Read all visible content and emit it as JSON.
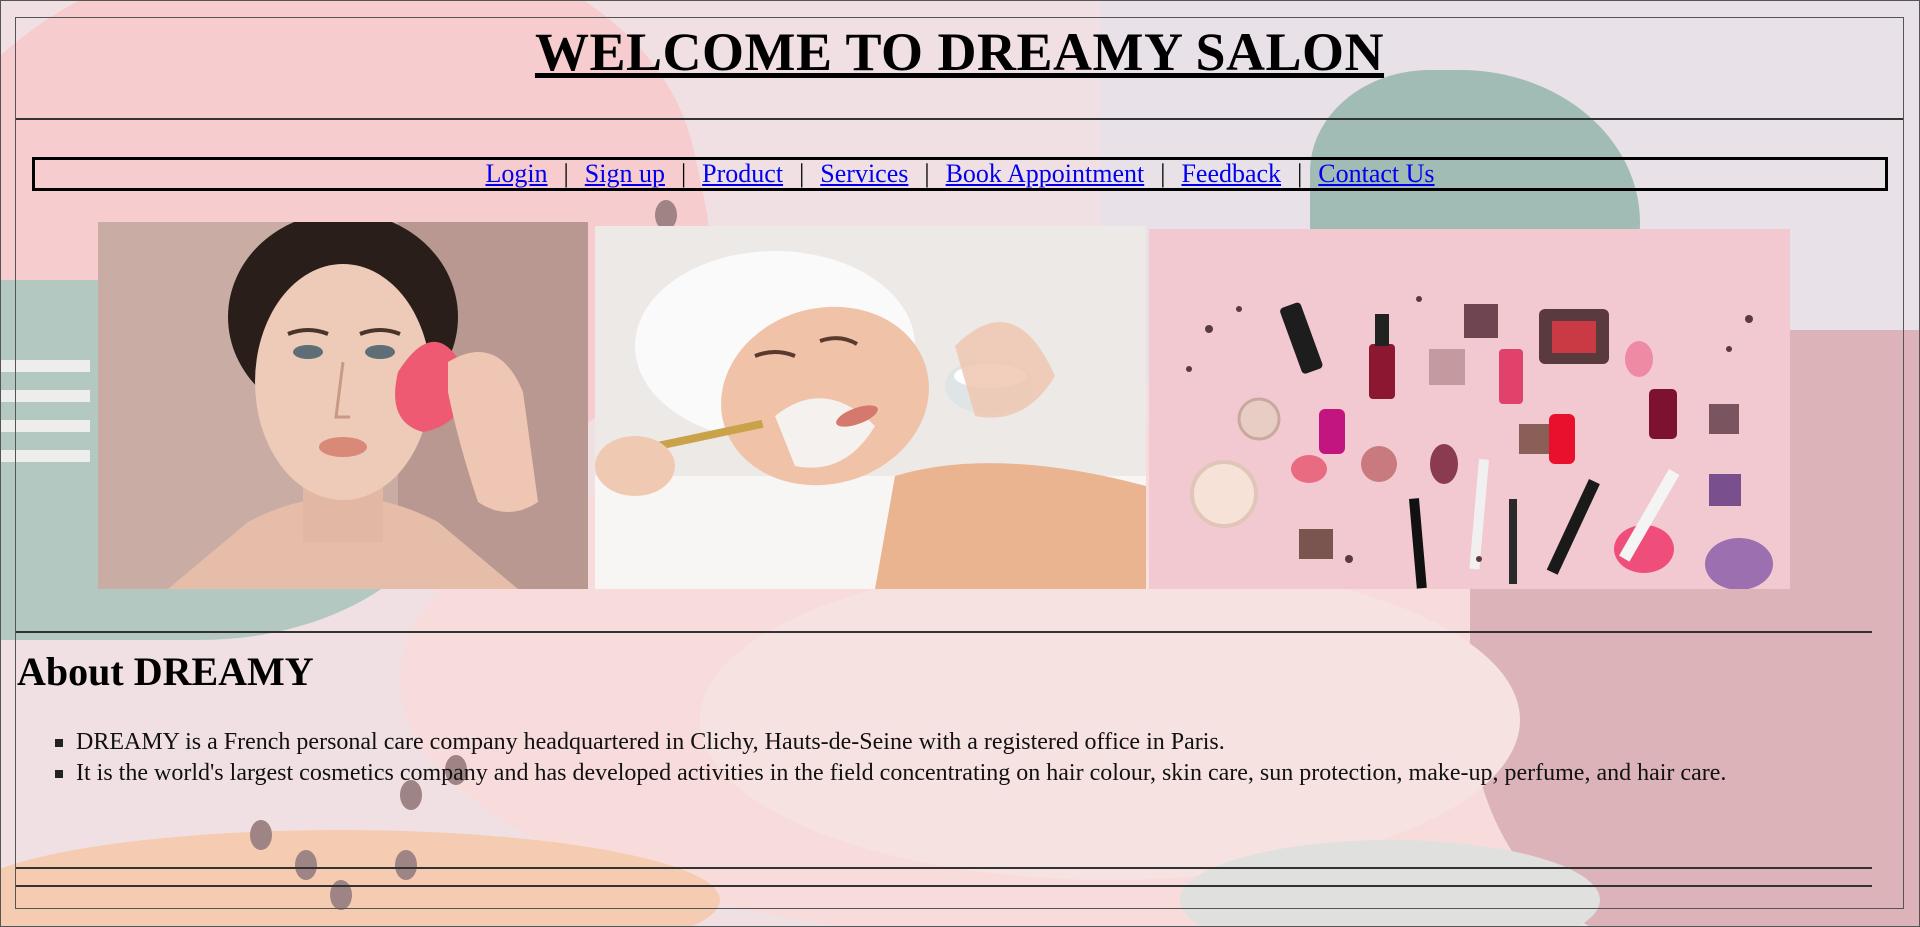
{
  "header": {
    "title": "WELCOME TO DREAMY SALON"
  },
  "nav": {
    "items": [
      {
        "label": "Login"
      },
      {
        "label": "Sign up"
      },
      {
        "label": "Product"
      },
      {
        "label": "Services"
      },
      {
        "label": "Book Appointment"
      },
      {
        "label": "Feedback"
      },
      {
        "label": "Contact Us"
      }
    ],
    "separator": "|",
    "link_color": "#0000ee"
  },
  "gallery": {
    "images": [
      {
        "name": "makeup-sponge-photo"
      },
      {
        "name": "facial-treatment-photo"
      },
      {
        "name": "cosmetics-flatlay-photo"
      }
    ]
  },
  "about": {
    "title": "About DREAMY",
    "items": [
      "DREAMY is a French personal care company headquartered in Clichy, Hauts-de-Seine with a registered office in Paris.",
      "It is the world's largest cosmetics company and has developed activities in the field concentrating on hair colour, skin care, sun protection, make-up, perfume, and hair care."
    ]
  }
}
